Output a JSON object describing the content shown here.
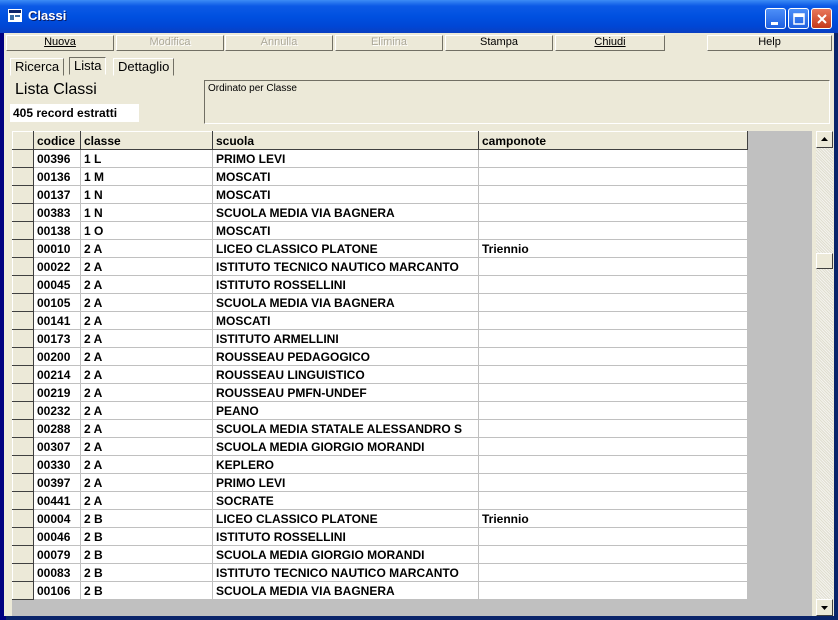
{
  "window": {
    "title": "Classi",
    "icon": "app-window-icon",
    "controls": [
      "minimize-icon",
      "maximize-icon",
      "close-icon"
    ]
  },
  "toolbar": {
    "nuova": "Nuova",
    "modifica": "Modifica",
    "annulla": "Annulla",
    "elimina": "Elimina",
    "stampa": "Stampa",
    "chiudi": "Chiudi",
    "help": "Help"
  },
  "tabs": [
    "Ricerca",
    "Lista",
    "Dettaglio"
  ],
  "active_tab": "Lista",
  "header": {
    "title": "Lista Classi",
    "count": "405 record estratti",
    "order": "Ordinato per Classe"
  },
  "grid": {
    "columns": [
      "codice",
      "classe",
      "scuola",
      "camponote"
    ],
    "rows": [
      [
        "00396",
        "1 L",
        "PRIMO LEVI",
        ""
      ],
      [
        "00136",
        "1 M",
        "MOSCATI",
        ""
      ],
      [
        "00137",
        "1 N",
        "MOSCATI",
        ""
      ],
      [
        "00383",
        "1 N",
        "SCUOLA MEDIA VIA BAGNERA",
        ""
      ],
      [
        "00138",
        "1 O",
        "MOSCATI",
        ""
      ],
      [
        "00010",
        "2 A",
        "LICEO CLASSICO PLATONE",
        "Triennio"
      ],
      [
        "00022",
        "2 A",
        "ISTITUTO TECNICO NAUTICO MARCANTO",
        ""
      ],
      [
        "00045",
        "2 A",
        "ISTITUTO ROSSELLINI",
        ""
      ],
      [
        "00105",
        "2 A",
        "SCUOLA MEDIA VIA BAGNERA",
        ""
      ],
      [
        "00141",
        "2 A",
        "MOSCATI",
        ""
      ],
      [
        "00173",
        "2 A",
        "ISTITUTO ARMELLINI",
        ""
      ],
      [
        "00200",
        "2 A",
        "ROUSSEAU PEDAGOGICO",
        ""
      ],
      [
        "00214",
        "2 A",
        "ROUSSEAU LINGUISTICO",
        ""
      ],
      [
        "00219",
        "2 A",
        "ROUSSEAU PMFN-UNDEF",
        ""
      ],
      [
        "00232",
        "2 A",
        "PEANO",
        ""
      ],
      [
        "00288",
        "2 A",
        "SCUOLA MEDIA STATALE ALESSANDRO S",
        ""
      ],
      [
        "00307",
        "2 A",
        "SCUOLA MEDIA GIORGIO MORANDI",
        ""
      ],
      [
        "00330",
        "2 A",
        "KEPLERO",
        ""
      ],
      [
        "00397",
        "2 A",
        "PRIMO LEVI",
        ""
      ],
      [
        "00441",
        "2 A",
        "SOCRATE",
        ""
      ],
      [
        "00004",
        "2 B",
        "LICEO CLASSICO PLATONE",
        "Triennio"
      ],
      [
        "00046",
        "2 B",
        "ISTITUTO ROSSELLINI",
        ""
      ],
      [
        "00079",
        "2 B",
        "SCUOLA MEDIA GIORGIO MORANDI",
        ""
      ],
      [
        "00083",
        "2 B",
        "ISTITUTO TECNICO NAUTICO MARCANTO",
        ""
      ],
      [
        "00106",
        "2 B",
        "SCUOLA MEDIA VIA BAGNERA",
        ""
      ]
    ]
  },
  "colors": {
    "titlebar": "#0050e0",
    "face": "#ece9d8",
    "grid_bg": "#c0c0c0"
  }
}
